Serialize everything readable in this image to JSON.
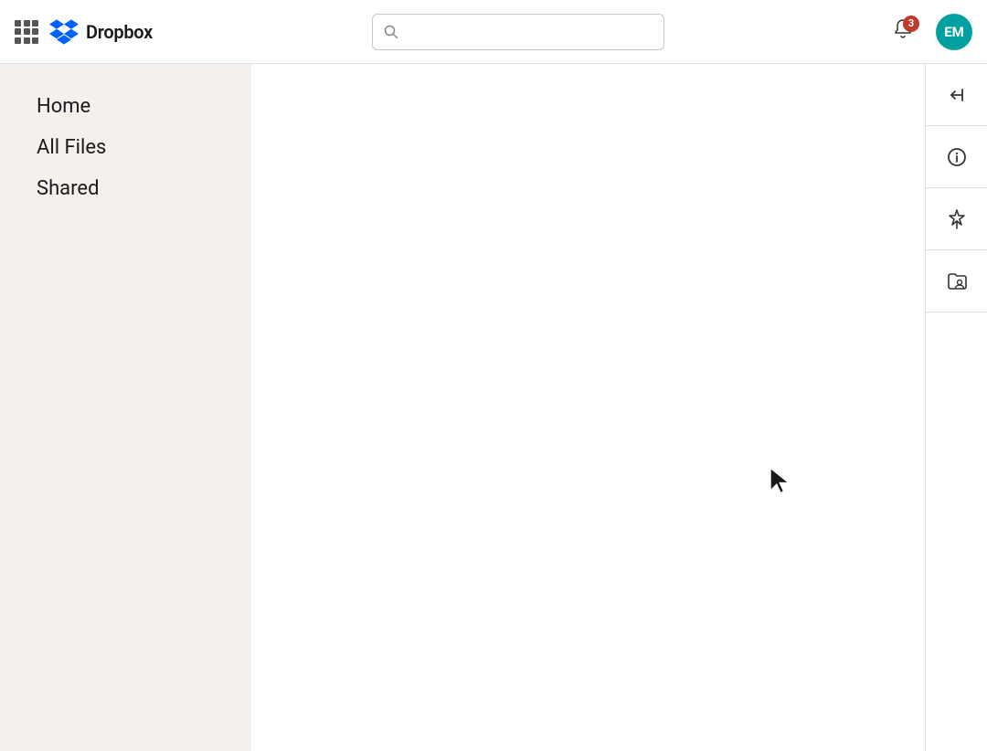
{
  "header": {
    "logo_text": "Dropbox",
    "search_placeholder": "",
    "notification_count": "3",
    "avatar_initials": "EM"
  },
  "sidebar": {
    "items": [
      {
        "label": "Home",
        "id": "home"
      },
      {
        "label": "All Files",
        "id": "all-files"
      },
      {
        "label": "Shared",
        "id": "shared"
      }
    ]
  },
  "right_panel": {
    "buttons": [
      {
        "icon": "collapse-left",
        "label": "Collapse panel"
      },
      {
        "icon": "info",
        "label": "Info"
      },
      {
        "icon": "pin",
        "label": "Pin"
      },
      {
        "icon": "folder-user",
        "label": "Folder sharing"
      }
    ]
  },
  "colors": {
    "accent_blue": "#0061ff",
    "notification_red": "#c0392b",
    "avatar_teal": "#00a0a0",
    "sidebar_bg": "#f5f0ee"
  }
}
